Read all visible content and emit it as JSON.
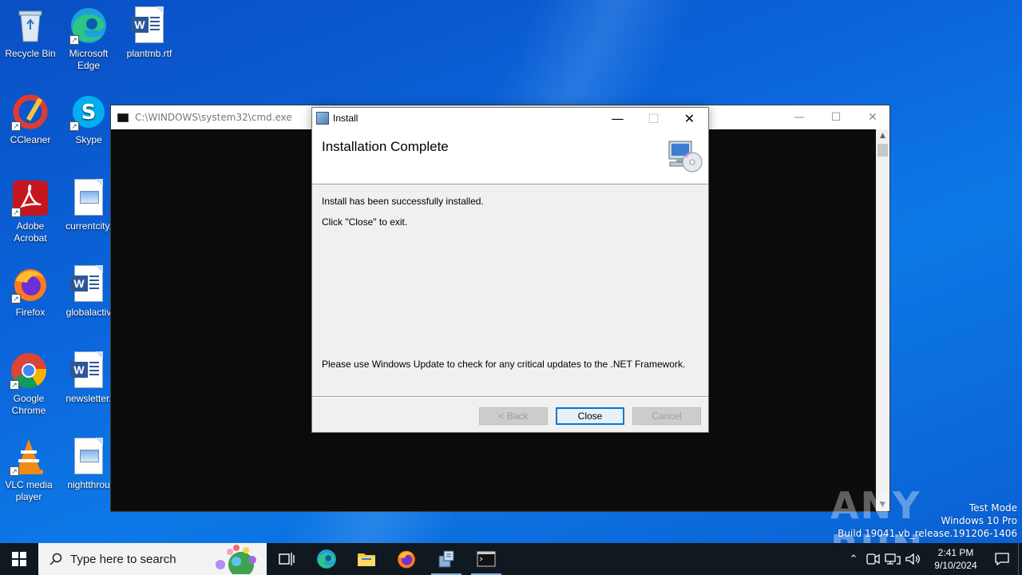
{
  "desktop": {
    "icons": [
      {
        "label": "Recycle Bin"
      },
      {
        "label": "Microsoft Edge"
      },
      {
        "label": "plantmb.rtf"
      },
      {
        "label": "CCleaner"
      },
      {
        "label": "Skype"
      },
      {
        "label": "Adobe Acrobat"
      },
      {
        "label": "currentcity."
      },
      {
        "label": "Firefox"
      },
      {
        "label": "globalactiv"
      },
      {
        "label": "Google Chrome"
      },
      {
        "label": "newsletter."
      },
      {
        "label": "VLC media player"
      },
      {
        "label": "nightthrou"
      }
    ]
  },
  "cmd": {
    "title": "C:\\WINDOWS\\system32\\cmd.exe"
  },
  "dialog": {
    "title": "Install",
    "heading": "Installation Complete",
    "message1": "Install has been successfully installed.",
    "message2": "Click \"Close\" to exit.",
    "message3": "Please use Windows Update to check for any critical updates to the .NET Framework.",
    "back_label": "< Back",
    "close_label": "Close",
    "cancel_label": "Cancel"
  },
  "watermark": {
    "brand": "ANY RUN",
    "line1": "Test Mode",
    "line2": "Windows 10 Pro",
    "line3": "Build 19041.vb_release.191206-1406"
  },
  "taskbar": {
    "search_placeholder": "Type here to search",
    "time": "2:41 PM",
    "date": "9/10/2024",
    "accent": "#0078d7"
  }
}
